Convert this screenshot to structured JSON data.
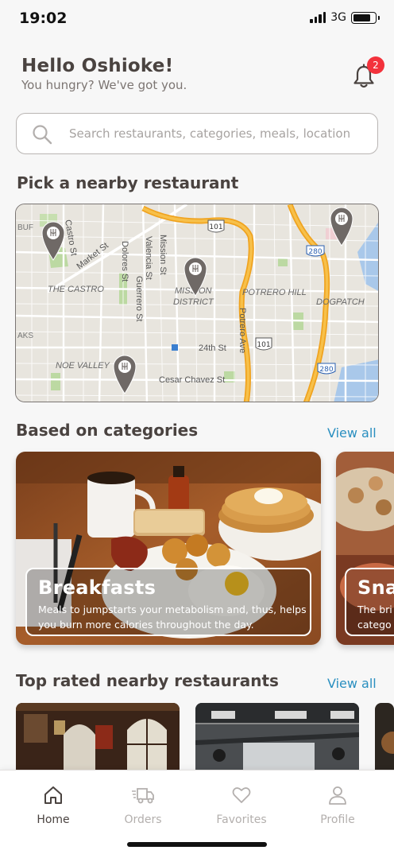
{
  "status": {
    "time": "19:02",
    "network": "3G"
  },
  "header": {
    "greeting": "Hello Oshioke!",
    "subtitle": "You hungry? We've got you.",
    "notification_count": "2"
  },
  "search": {
    "placeholder": "Search restaurants, categories, meals, location"
  },
  "nearby": {
    "title": "Pick a nearby restaurant",
    "map_labels": {
      "castro_st": "Castro St",
      "market_st": "Market St",
      "dolores_st": "Dolores St",
      "valencia_st": "Valencia St",
      "guerrero_st": "Guerrero St",
      "mission_st": "Mission St",
      "the_castro": "THE CASTRO",
      "mission_district_1": "MISSION",
      "mission_district_2": "DISTRICT",
      "potrero_hill": "POTRERO HILL",
      "dogpatch": "DOGPATCH",
      "potrero_ave": "Potrero Ave",
      "st_24th": "24th St",
      "noe_valley": "NOE VALLEY",
      "cesar_chavez": "Cesar Chavez St",
      "hwy_101_a": "101",
      "hwy_101_b": "101",
      "hwy_280_a": "280",
      "hwy_280_b": "280",
      "buf": "BUF",
      "aks": "AKS"
    }
  },
  "categories": {
    "title": "Based on categories",
    "view_all": "View all",
    "items": [
      {
        "name": "Breakfasts",
        "description": "Meals to jumpstarts your metabolism and, thus, helps you burn more calories throughout the day."
      },
      {
        "name": "Sna",
        "description": "The bri catego"
      }
    ]
  },
  "top_rated": {
    "title": "Top rated nearby restaurants",
    "view_all": "View all"
  },
  "tabbar": {
    "home": "Home",
    "orders": "Orders",
    "favorites": "Favorites",
    "profile": "Profile"
  },
  "colors": {
    "accent": "#2a8fc0",
    "badge": "#f3323c",
    "text": "#4a4340",
    "inactive": "#b3afad"
  }
}
